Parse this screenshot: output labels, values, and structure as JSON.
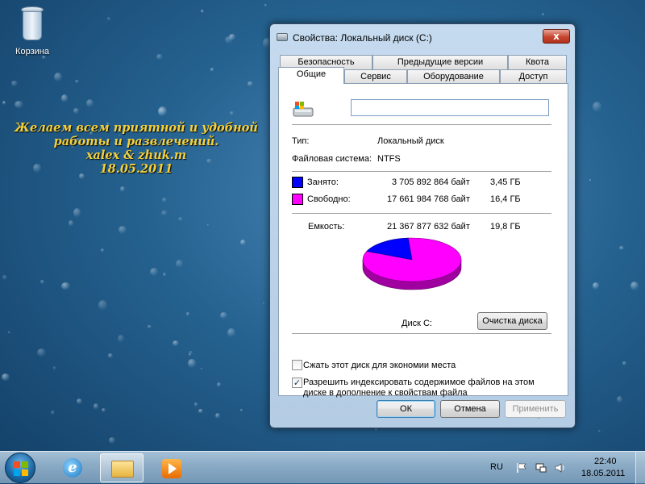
{
  "desktop": {
    "recycle_bin_label": "Корзина",
    "greeting_lines": [
      "Желаем всем приятной и удобной",
      "работы и развлечений.",
      "xalex & zhuk.m",
      "18.05.2011"
    ]
  },
  "window": {
    "title": "Свойства: Локальный диск (C:)",
    "close_symbol": "x",
    "tabs_row1": [
      "Безопасность",
      "Предыдущие версии",
      "Квота"
    ],
    "tabs_row2": [
      "Общие",
      "Сервис",
      "Оборудование",
      "Доступ"
    ],
    "active_tab": "Общие",
    "drive_name_value": "",
    "type_label": "Тип:",
    "type_value": "Локальный диск",
    "fs_label": "Файловая система:",
    "fs_value": "NTFS",
    "used": {
      "label": "Занято:",
      "bytes": "3 705 892 864 байт",
      "size": "3,45 ГБ",
      "color": "#0000ff"
    },
    "free": {
      "label": "Свободно:",
      "bytes": "17 661 984 768 байт",
      "size": "16,4 ГБ",
      "color": "#ff00ff"
    },
    "capacity": {
      "label": "Емкость:",
      "bytes": "21 367 877 632 байт",
      "size": "19,8 ГБ"
    },
    "used_fraction": 0.1734,
    "disk_label": "Диск C:",
    "cleanup_button": "Очистка диска",
    "compress_checkbox": {
      "label": "Сжать этот диск для экономии места",
      "checked": false
    },
    "index_checkbox": {
      "label_line1": "Разрешить индексировать содержимое файлов на этом",
      "label_line2": "диске в дополнение к свойствам файла",
      "checked": true,
      "check_mark": "✓"
    },
    "ok_button": "ОК",
    "cancel_button": "Отмена",
    "apply_button": "Применить"
  },
  "taskbar": {
    "language": "RU",
    "time": "22:40",
    "date": "18.05.2011"
  }
}
